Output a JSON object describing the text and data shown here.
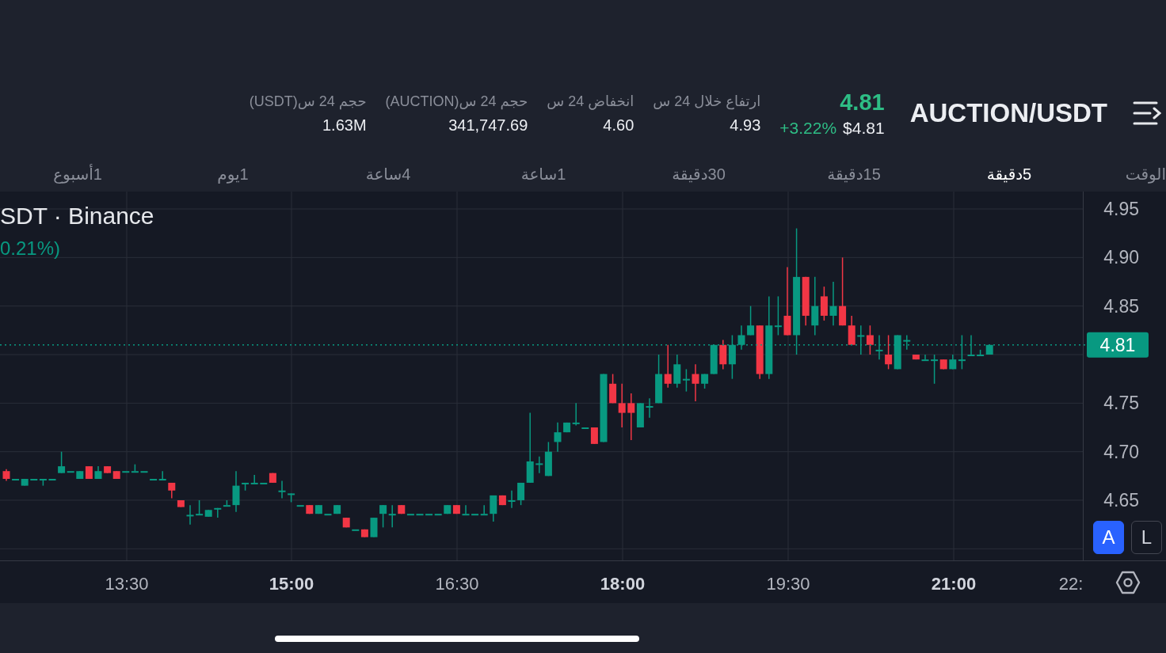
{
  "header": {
    "title": "AUCTION/USDT",
    "price": "4.81",
    "price_usd": "$4.81",
    "change": "+3.22%",
    "stats": [
      {
        "label": "ارتفاع خلال 24 س",
        "value": "4.93"
      },
      {
        "label": "انخفاض 24 س",
        "value": "4.60"
      },
      {
        "label": "حجم 24 س(AUCTION)",
        "value": "341,747.69"
      },
      {
        "label": "حجم 24 س(USDT)",
        "value": "1.63M"
      }
    ]
  },
  "intervals": {
    "label": "الوقت",
    "tabs": [
      {
        "label": "5دقيقة",
        "selected": true
      },
      {
        "label": "15دقيقة",
        "selected": false
      },
      {
        "label": "30دقيقة",
        "selected": false
      },
      {
        "label": "1ساعة",
        "selected": false
      },
      {
        "label": "4ساعة",
        "selected": false
      },
      {
        "label": "1يوم",
        "selected": false
      },
      {
        "label": "1أسبوع",
        "selected": false
      }
    ]
  },
  "chart": {
    "legend_symbol": "SDT · Binance",
    "legend_change": "0.21%)",
    "price_axis": [
      "4.95",
      "4.90",
      "4.85",
      "4.75",
      "4.70",
      "4.65"
    ],
    "current_price": "4.81",
    "time_axis": [
      {
        "label": "22:",
        "major": false
      },
      {
        "label": "21:00",
        "major": true
      },
      {
        "label": "19:30",
        "major": false
      },
      {
        "label": "18:00",
        "major": true
      },
      {
        "label": "16:30",
        "major": false
      },
      {
        "label": "15:00",
        "major": true
      },
      {
        "label": "13:30",
        "major": false
      }
    ],
    "scale_buttons": [
      {
        "label": "L",
        "selected": false
      },
      {
        "label": "A",
        "selected": true
      }
    ]
  }
}
